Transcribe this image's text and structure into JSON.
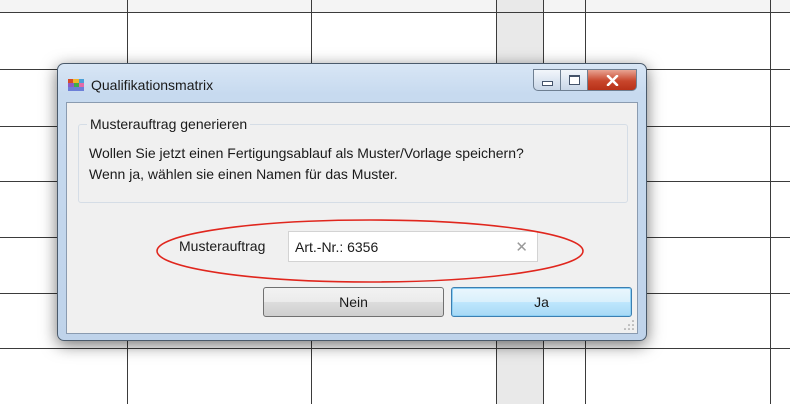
{
  "window": {
    "title": "Qualifikationsmatrix",
    "app_icon": "app-icon",
    "controls": {
      "minimize_icon": "minimize-icon",
      "maximize_icon": "maximize-icon",
      "close_icon": "close-icon"
    }
  },
  "group": {
    "title": "Musterauftrag generieren",
    "line1": "Wollen Sie jetzt einen Fertigungsablauf als Muster/Vorlage speichern?",
    "line2": "Wenn ja, wählen sie einen Namen für das Muster."
  },
  "field": {
    "label": "Musterauftrag",
    "value": "Art.-Nr.: 6356",
    "clear_glyph": "✕"
  },
  "buttons": {
    "no": "Nein",
    "yes": "Ja"
  },
  "colors": {
    "annotation": "#e0261d",
    "close_button": "#c8462c",
    "default_button_border": "#3c7fb1"
  }
}
